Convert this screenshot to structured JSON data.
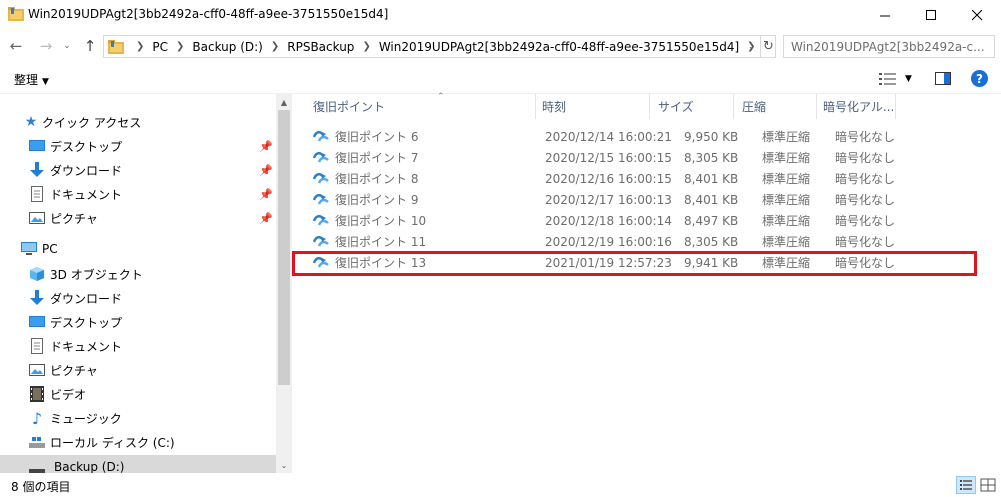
{
  "window": {
    "title": "Win2019UDPAgt2[3bb2492a-cff0-48ff-a9ee-3751550e15d4]",
    "minimize_glyph": "—",
    "maximize_glyph": "☐",
    "close_glyph": "✕"
  },
  "address": {
    "crumbs": [
      "PC",
      "Backup (D:)",
      "RPSBackup",
      "Win2019UDPAgt2[3bb2492a-cff0-48ff-a9ee-3751550e15d4]"
    ],
    "search_placeholder": "Win2019UDPAgt2[3bb2492a-c..."
  },
  "toolbar": {
    "organize_label": "整理"
  },
  "nav": {
    "quick_access": "クイック アクセス",
    "qa_items": [
      "デスクトップ",
      "ダウンロード",
      "ドキュメント",
      "ピクチャ"
    ],
    "pc": "PC",
    "pc_items": [
      "3D オブジェクト",
      "ダウンロード",
      "デスクトップ",
      "ドキュメント",
      "ピクチャ",
      "ビデオ",
      "ミュージック",
      "ローカル ディスク (C:)",
      "Backup (D:)"
    ]
  },
  "columns": {
    "name": "復旧ポイント",
    "time": "時刻",
    "size": "サイズ",
    "compression": "圧縮",
    "encryption": "暗号化アル..."
  },
  "rows": [
    {
      "name": "復旧ポイント 6",
      "time": "2020/12/14 16:00:21",
      "size": "9,950 KB",
      "compression": "標準圧縮",
      "encryption": "暗号化なし"
    },
    {
      "name": "復旧ポイント 7",
      "time": "2020/12/15 16:00:15",
      "size": "8,305 KB",
      "compression": "標準圧縮",
      "encryption": "暗号化なし"
    },
    {
      "name": "復旧ポイント 8",
      "time": "2020/12/16 16:00:15",
      "size": "8,401 KB",
      "compression": "標準圧縮",
      "encryption": "暗号化なし"
    },
    {
      "name": "復旧ポイント 9",
      "time": "2020/12/17 16:00:13",
      "size": "8,401 KB",
      "compression": "標準圧縮",
      "encryption": "暗号化なし"
    },
    {
      "name": "復旧ポイント 10",
      "time": "2020/12/18 16:00:14",
      "size": "8,497 KB",
      "compression": "標準圧縮",
      "encryption": "暗号化なし"
    },
    {
      "name": "復旧ポイント 11",
      "time": "2020/12/19 16:00:16",
      "size": "8,305 KB",
      "compression": "標準圧縮",
      "encryption": "暗号化なし"
    },
    {
      "name": "復旧ポイント 13",
      "time": "2021/01/19 12:57:23",
      "size": "9,941 KB",
      "compression": "標準圧縮",
      "encryption": "暗号化なし"
    }
  ],
  "status": {
    "item_count": "8 個の項目"
  },
  "colors": {
    "highlight_border": "#e0141e",
    "header_text": "#4c607a",
    "selected_nav": "#d9d9d9"
  }
}
